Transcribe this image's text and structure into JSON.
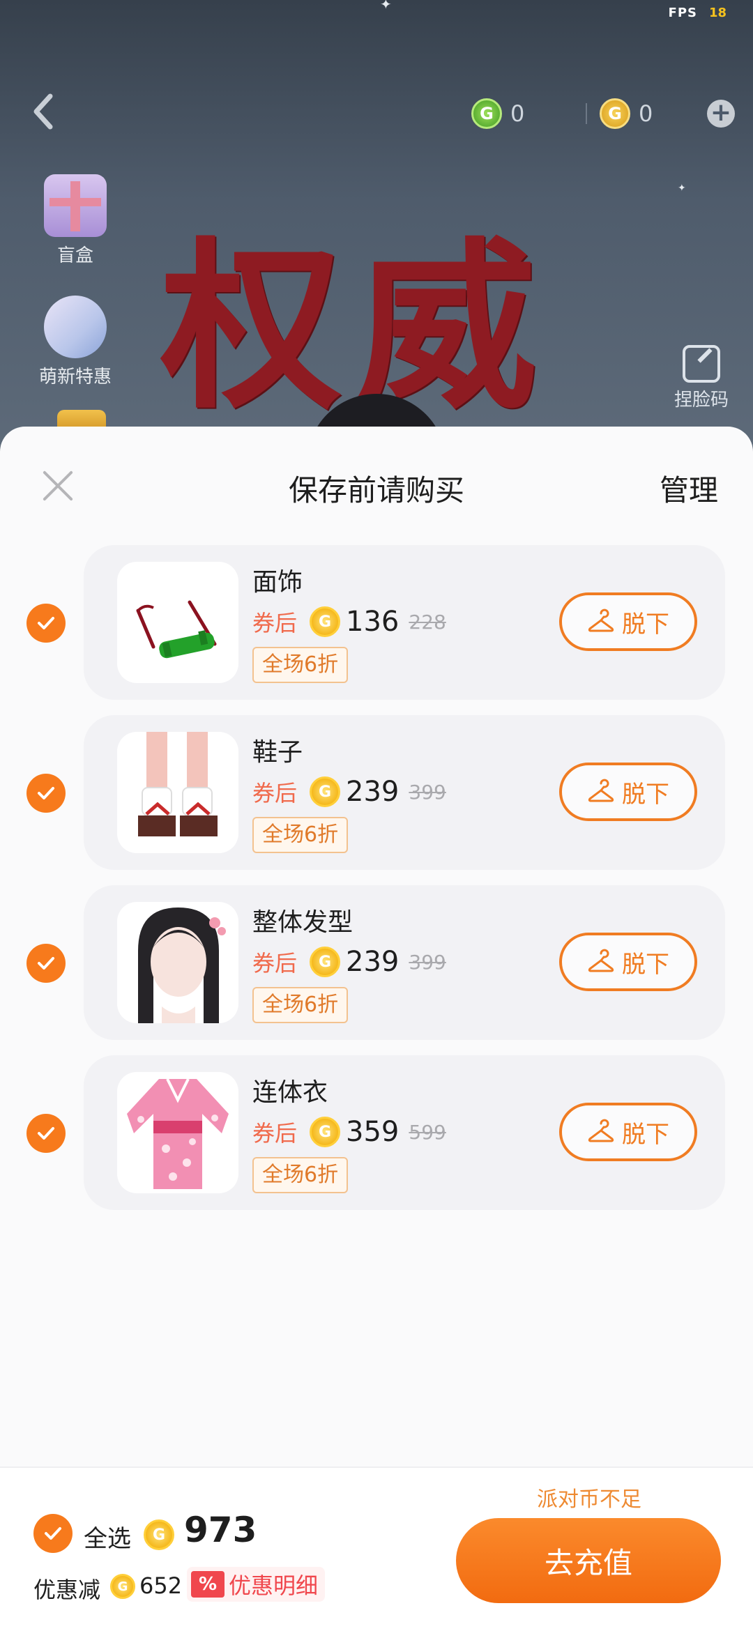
{
  "status": {
    "fps_label": "FPS",
    "fps_value": "18"
  },
  "topbar": {
    "currency_green": {
      "icon": "g-coin-green-icon",
      "value": "0"
    },
    "currency_gold": {
      "icon": "g-coin-gold-icon",
      "value": "0"
    }
  },
  "sidebar": {
    "items": [
      {
        "label": "盲盒",
        "icon": "gift-box-icon"
      },
      {
        "label": "萌新特惠",
        "icon": "newbie-deal-icon"
      }
    ],
    "pinch_face_label": "捏脸码"
  },
  "banner": {
    "text": "权威"
  },
  "sheet": {
    "title": "保存前请购买",
    "manage_label": "管理",
    "coupon_label": "券后",
    "discount_badge": "全场6折",
    "takeoff_label": "脱下",
    "items": [
      {
        "name": "面饰",
        "price": "136",
        "original_price": "228",
        "checked": true
      },
      {
        "name": "鞋子",
        "price": "239",
        "original_price": "399",
        "checked": true
      },
      {
        "name": "整体发型",
        "price": "239",
        "original_price": "399",
        "checked": true
      },
      {
        "name": "连体衣",
        "price": "359",
        "original_price": "599",
        "checked": true
      }
    ]
  },
  "footer": {
    "insufficient_text": "派对币不足",
    "select_all_label": "全选",
    "total": "973",
    "discount_label": "优惠减",
    "discount_amount": "652",
    "discount_detail_icon": "%",
    "discount_detail_label": "优惠明细",
    "recharge_label": "去充值"
  },
  "colors": {
    "accent": "#f77a1c",
    "coupon_red": "#f06a4c",
    "coin_gold": "#f5b81c"
  }
}
